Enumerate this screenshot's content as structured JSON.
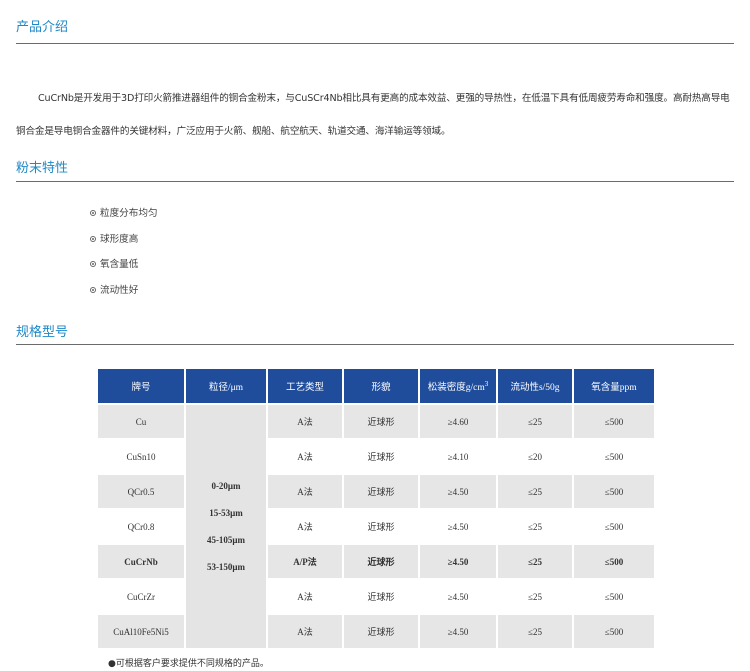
{
  "sections": {
    "intro_title": "产品介绍",
    "powder_title": "粉末特性",
    "spec_title": "规格型号"
  },
  "intro": {
    "text": "CuCrNb是开发用于3D打印火箭推进器组件的铜合金粉末，与CuSCr4Nb相比具有更高的成本效益、更强的导热性，在低温下具有低周疲劳寿命和强度。高耐热高导电铜合金是导电铜合金器件的关键材料，广泛应用于火箭、舰船、航空航天、轨道交通、海洋输运等领域。"
  },
  "features": [
    "粒度分布均匀",
    "球形度高",
    "氧含量低",
    "流动性好"
  ],
  "table": {
    "headers": [
      "牌号",
      "粒径/μm",
      "工艺类型",
      "形貌",
      "松装密度g/cm",
      "流动性s/50g",
      "氧含量ppm"
    ],
    "density_sup": "3",
    "size_values": [
      "0-20μm",
      "15-53μm",
      "45-105μm",
      "53-150μm"
    ],
    "rows": [
      {
        "grade": "Cu",
        "process": "A法",
        "morphology": "近球形",
        "density": "≥4.60",
        "flow": "≤25",
        "oxygen": "≤500"
      },
      {
        "grade": "CuSn10",
        "process": "A法",
        "morphology": "近球形",
        "density": "≥4.10",
        "flow": "≤20",
        "oxygen": "≤500"
      },
      {
        "grade": "QCr0.5",
        "process": "A法",
        "morphology": "近球形",
        "density": "≥4.50",
        "flow": "≤25",
        "oxygen": "≤500"
      },
      {
        "grade": "QCr0.8",
        "process": "A法",
        "morphology": "近球形",
        "density": "≥4.50",
        "flow": "≤25",
        "oxygen": "≤500"
      },
      {
        "grade": "CuCrNb",
        "process": "A/P法",
        "morphology": "近球形",
        "density": "≥4.50",
        "flow": "≤25",
        "oxygen": "≤500"
      },
      {
        "grade": "CuCrZr",
        "process": "A法",
        "morphology": "近球形",
        "density": "≥4.50",
        "flow": "≤25",
        "oxygen": "≤500"
      },
      {
        "grade": "CuAl10Fe5Ni5",
        "process": "A法",
        "morphology": "近球形",
        "density": "≥4.50",
        "flow": "≤25",
        "oxygen": "≤500"
      }
    ]
  },
  "note": "●可根据客户要求提供不同规格的产品。",
  "colors": {
    "title_blue": "#1e88c7",
    "header_blue": "#1f4d9c",
    "stripe_gray": "#e6e6e6"
  }
}
